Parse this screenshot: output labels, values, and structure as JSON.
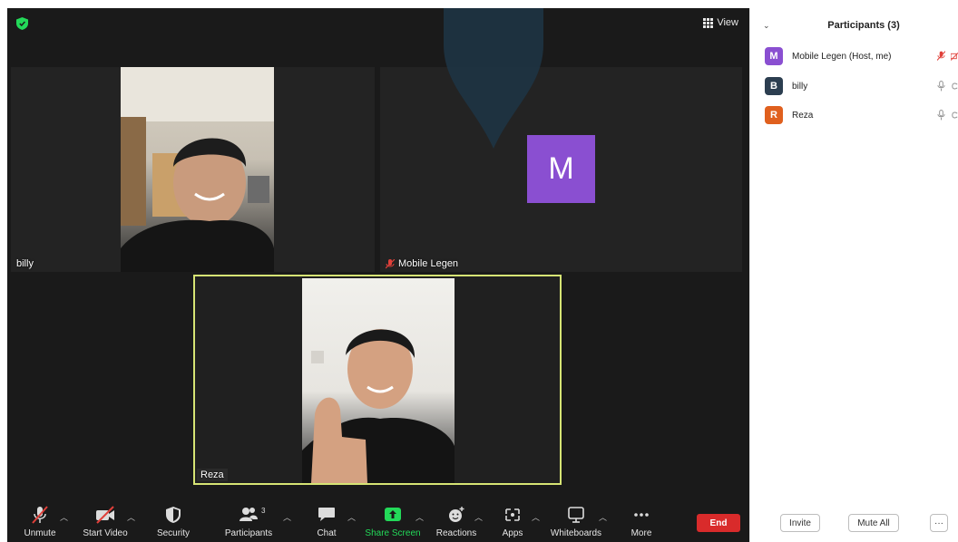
{
  "meeting": {
    "view_label": "View",
    "tiles": {
      "billy": {
        "name": "billy"
      },
      "mobile_legen": {
        "name": "Mobile Legen",
        "avatar_letter": "M"
      },
      "reza": {
        "name": "Reza"
      }
    },
    "toolbar": {
      "unmute": "Unmute",
      "start_video": "Start Video",
      "security": "Security",
      "participants": "Participants",
      "participants_count": "3",
      "chat": "Chat",
      "share_screen": "Share Screen",
      "reactions": "Reactions",
      "apps": "Apps",
      "whiteboards": "Whiteboards",
      "more": "More",
      "end": "End"
    }
  },
  "panel": {
    "title": "Participants (3)",
    "participants": [
      {
        "initial": "M",
        "name": "Mobile Legen (Host, me)",
        "avatar_color": "#8a4fd1"
      },
      {
        "initial": "B",
        "name": "billy",
        "avatar_color": "#2c3e50"
      },
      {
        "initial": "R",
        "name": "Reza",
        "avatar_color": "#e0601e"
      }
    ],
    "footer": {
      "invite": "Invite",
      "mute_all": "Mute All",
      "more": "···"
    }
  },
  "colors": {
    "accent_green": "#23d959",
    "end_red": "#d92b2b",
    "active_speaker_border": "#d6e474",
    "muted_red": "#e0403a"
  }
}
